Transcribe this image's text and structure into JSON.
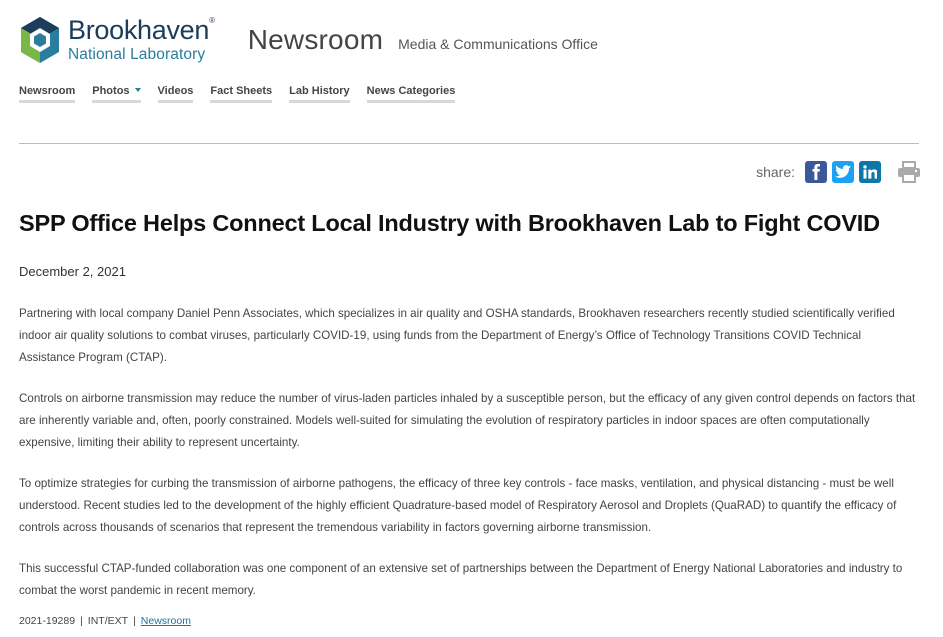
{
  "brand": {
    "name": "Brookhaven",
    "trademark": "®",
    "subname": "National Laboratory",
    "colors": {
      "navy": "#1b3c5a",
      "teal": "#2a7d9c",
      "green": "#7ab648"
    }
  },
  "site": {
    "title": "Newsroom",
    "subtitle": "Media & Communications Office"
  },
  "nav": {
    "items": [
      {
        "label": "Newsroom"
      },
      {
        "label": "Photos",
        "has_dropdown": true
      },
      {
        "label": "Videos"
      },
      {
        "label": "Fact Sheets"
      },
      {
        "label": "Lab History"
      },
      {
        "label": "News Categories"
      }
    ]
  },
  "share": {
    "label": "share:",
    "icons": [
      "facebook-icon",
      "twitter-icon",
      "linkedin-icon",
      "print-icon"
    ]
  },
  "article": {
    "title": "SPP Office Helps Connect Local Industry with Brookhaven Lab to Fight COVID",
    "date": "December 2, 2021",
    "paragraphs": [
      "Partnering with local company Daniel Penn Associates, which specializes in air quality and OSHA standards, Brookhaven researchers recently studied scientifically verified indoor air quality solutions to combat viruses, particularly COVID-19, using funds from the Department of Energy’s Office of Technology Transitions COVID Technical Assistance Program (CTAP).",
      "Controls on airborne transmission may reduce the number of virus-laden particles inhaled by a susceptible person, but the efficacy of any given control depends on factors that are inherently variable and, often, poorly constrained. Models well-suited for simulating the evolution of respiratory particles in indoor spaces are often computationally expensive, limiting their ability to represent uncertainty.",
      "To optimize strategies for curbing the transmission of airborne pathogens, the efficacy of three key controls - face masks, ventilation, and physical distancing - must be well understood. Recent studies led to the development of the highly efficient Quadrature-based model of Respiratory Aerosol and Droplets (QuaRAD) to quantify the efficacy of controls across thousands of scenarios that represent the tremendous variability in factors governing airborne transmission.",
      "This successful CTAP-funded collaboration was one component of an extensive set of partnerships between the Department of Energy National Laboratories and industry to combat the worst pandemic in recent memory."
    ],
    "footer": {
      "id": "2021-19289",
      "sep": "|",
      "audience": "INT/EXT",
      "category_link": "Newsroom"
    }
  }
}
